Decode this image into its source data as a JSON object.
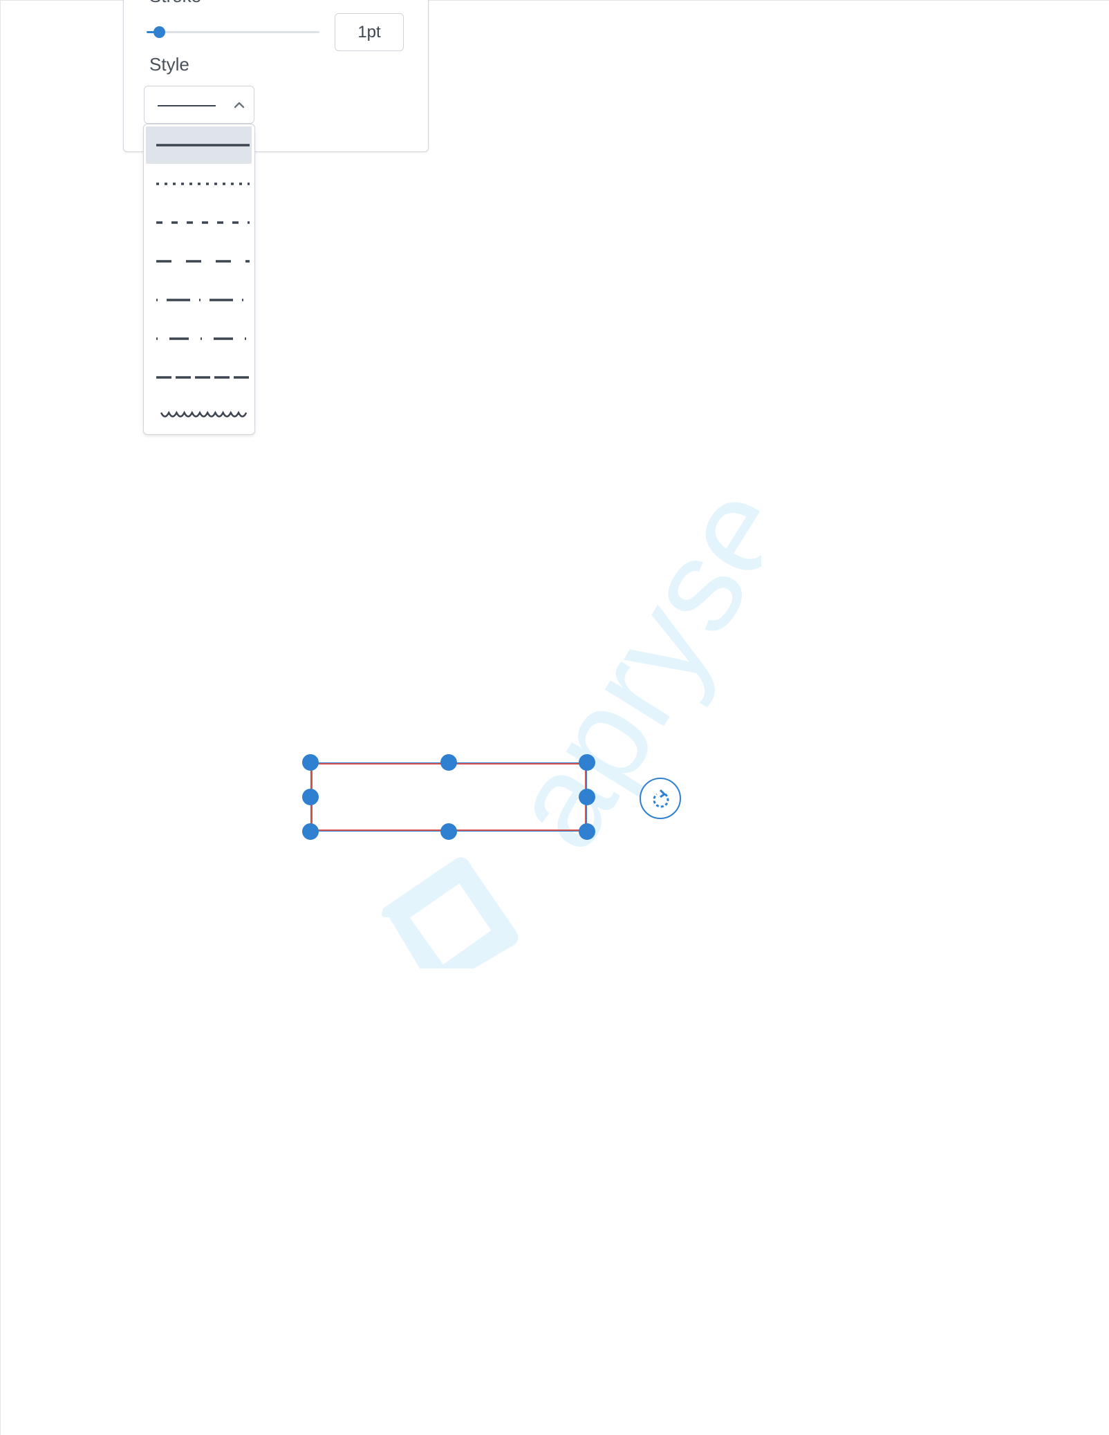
{
  "stroke": {
    "label": "Stroke",
    "value": "1pt",
    "slider_fraction": 0.07
  },
  "style": {
    "label": "Style",
    "selected": "solid",
    "options": [
      "solid",
      "dotted",
      "dashed-short",
      "dashed-long",
      "dash-dot",
      "dash-dot-short",
      "dashed-dense",
      "cloudy"
    ]
  },
  "watermark": {
    "text": "apryse"
  },
  "colors": {
    "accent": "#2f80d1",
    "shape_stroke": "#d9534f",
    "watermark": "#e3f4fc",
    "line": "#3d4550"
  }
}
